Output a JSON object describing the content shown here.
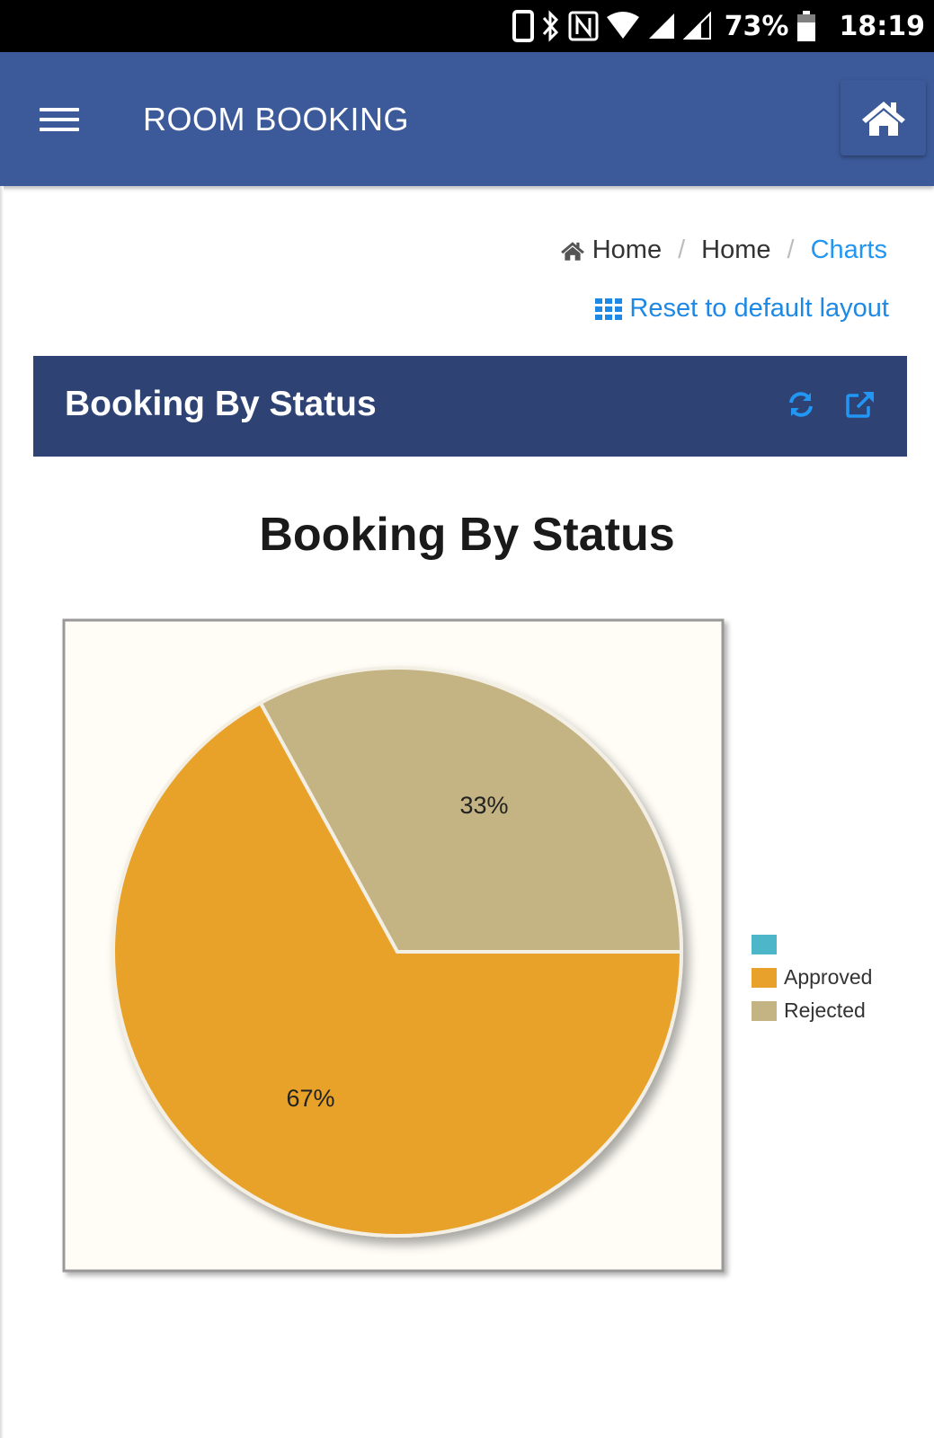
{
  "status_bar": {
    "battery": "73%",
    "time": "18:19"
  },
  "app_bar": {
    "title": "ROOM BOOKING",
    "menu_icon": "hamburger-menu-icon",
    "home_icon": "home-icon"
  },
  "breadcrumb": {
    "items": [
      "Home",
      "Home",
      "Charts"
    ]
  },
  "reset_link": "Reset to default layout",
  "panel": {
    "title": "Booking By Status"
  },
  "colors": {
    "header": "#3c5a99",
    "panel": "#2e4374",
    "link": "#2196f3",
    "approved": "#e8a22c",
    "rejected": "#c4b383",
    "unnamed": "#4db6c8",
    "plot_bg": "#fffdf6"
  },
  "chart_data": {
    "type": "pie",
    "title": "Booking By Status",
    "series": [
      {
        "name": "",
        "value": 0,
        "color": "#4db6c8"
      },
      {
        "name": "Approved",
        "value": 67,
        "label": "67%",
        "color": "#e8a22c"
      },
      {
        "name": "Rejected",
        "value": 33,
        "label": "33%",
        "color": "#c4b383"
      }
    ],
    "legend": "right"
  }
}
